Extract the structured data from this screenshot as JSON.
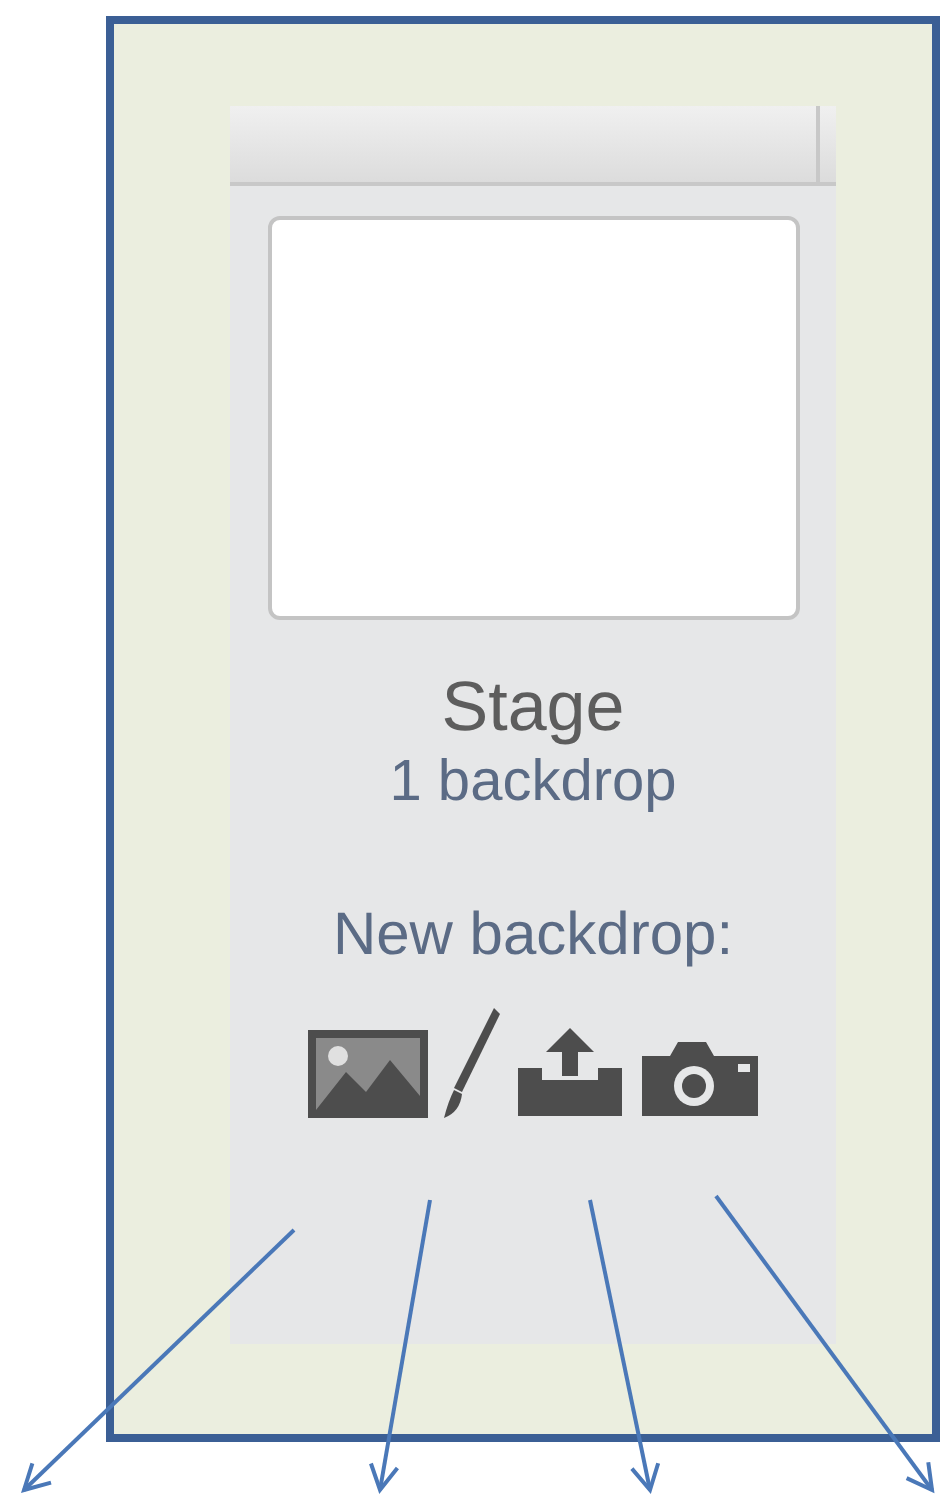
{
  "stage": {
    "title": "Stage",
    "count": "1 backdrop"
  },
  "new_backdrop": {
    "label": "New backdrop:",
    "tools": [
      {
        "kind": "library"
      },
      {
        "kind": "paint"
      },
      {
        "kind": "upload"
      },
      {
        "kind": "camera"
      }
    ]
  }
}
